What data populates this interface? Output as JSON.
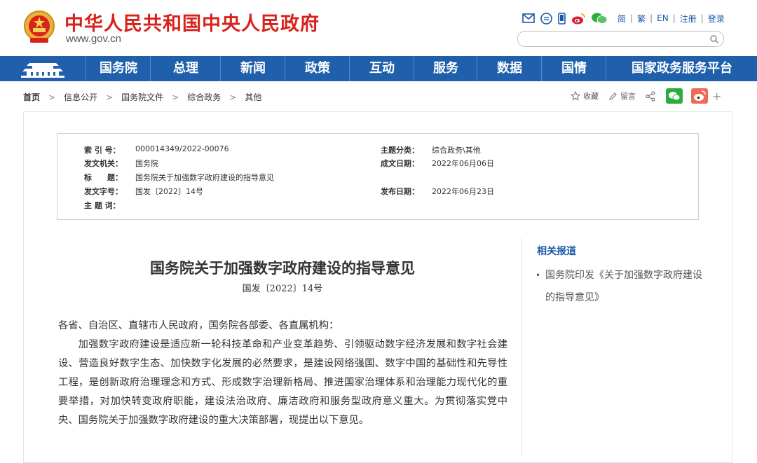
{
  "header": {
    "title": "中华人民共和国中央人民政府",
    "url": "www.gov.cn",
    "icons": [
      "mail-icon",
      "chat-icon",
      "mobile-icon",
      "weibo-icon",
      "wechat-icon"
    ],
    "lang_links": [
      "简",
      "繁",
      "EN",
      "注册",
      "登录"
    ],
    "separator": "|",
    "search": {
      "value": "",
      "placeholder": ""
    }
  },
  "nav": {
    "items": [
      "国务院",
      "总理",
      "新闻",
      "政策",
      "互动",
      "服务",
      "数据",
      "国情",
      "国家政务服务平台"
    ]
  },
  "breadcrumb": {
    "items": [
      "首页",
      "信息公开",
      "国务院文件",
      "综合政务",
      "其他"
    ],
    "separator": ">"
  },
  "share": {
    "favorite": "收藏",
    "comment": "留言",
    "plus": "+"
  },
  "meta": {
    "index_no_label": "索 引 号：",
    "index_no": "000014349/2022-00076",
    "issuer_label": "发文机关：",
    "issuer": "国务院",
    "title_label": "标　　题：",
    "title": "国务院关于加强数字政府建设的指导意见",
    "doc_no_label": "发文字号：",
    "doc_no": "国发〔2022〕14号",
    "keywords_label": "主 题 词：",
    "keywords": "",
    "category_label": "主题分类：",
    "category": "综合政务\\其他",
    "written_label": "成文日期：",
    "written": "2022年06月06日",
    "published_label": "发布日期：",
    "published": "2022年06月23日"
  },
  "article": {
    "title": "国务院关于加强数字政府建设的指导意见",
    "doc_no": "国发〔2022〕14号",
    "salutation": "各省、自治区、直辖市人民政府，国务院各部委、各直属机构：",
    "paragraph1": "加强数字政府建设是适应新一轮科技革命和产业变革趋势、引领驱动数字经济发展和数字社会建设、营造良好数字生态、加快数字化发展的必然要求，是建设网络强国、数字中国的基础性和先导性工程，是创新政府治理理念和方式、形成数字治理新格局、推进国家治理体系和治理能力现代化的重要举措，对加快转变政府职能，建设法治政府、廉洁政府和服务型政府意义重大。为贯彻落实党中央、国务院关于加强数字政府建设的重大决策部署，现提出以下意见。"
  },
  "related": {
    "title": "相关报道",
    "items": [
      "国务院印发《关于加强数字政府建设的指导意见》"
    ],
    "bullet": "•"
  },
  "colors": {
    "brand_red": "#d8221b",
    "nav_blue": "#1f5fab",
    "link_blue": "#1a59a8"
  }
}
